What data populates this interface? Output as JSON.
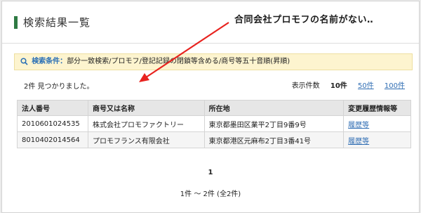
{
  "header": {
    "title": "検索結果一覧"
  },
  "annotation": "合同会社プロモフの名前がない‥",
  "conditions": {
    "label": "検索条件：",
    "text": "部分一致検索/プロモフ/登記記録の閉鎖等含める/商号等五十音順(昇順)"
  },
  "results": {
    "found_text": "2件 見つかりました。",
    "per_page": {
      "label": "表示件数",
      "options": [
        "10件",
        "50件",
        "100件"
      ],
      "selected": "10件"
    },
    "columns": [
      "法人番号",
      "商号又は名称",
      "所在地",
      "変更履歴情報等"
    ],
    "rows": [
      {
        "number": "2010601024535",
        "name": "株式会社プロモファクトリー",
        "address": "東京都墨田区業平2丁目9番9号",
        "history": "履歴等"
      },
      {
        "number": "8010402014564",
        "name": "プロモフランス有限会社",
        "address": "東京都港区元麻布2丁目3番41号",
        "history": "履歴等"
      }
    ]
  },
  "pagination": {
    "current_page": "1",
    "summary": "1件 ～ 2件 (全2件)"
  },
  "colors": {
    "accent": "#2e7a43",
    "link": "#2f6db3",
    "condition_bg": "#fdf4cf",
    "arrow": "#e8231f"
  },
  "icons": {
    "search": "search-icon"
  }
}
